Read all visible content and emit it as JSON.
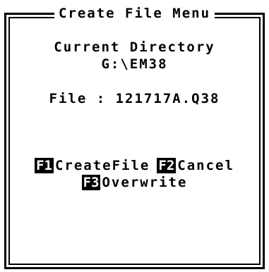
{
  "dialog": {
    "title": "Create File Menu",
    "current_directory_label": "Current Directory",
    "current_directory_value": "G:\\EM38",
    "file_line": "File : 121717A.Q38"
  },
  "actions": [
    {
      "key": "F1",
      "label": "CreateFile"
    },
    {
      "key": "F2",
      "label": "Cancel"
    },
    {
      "key": "F3",
      "label": "Overwrite"
    }
  ]
}
